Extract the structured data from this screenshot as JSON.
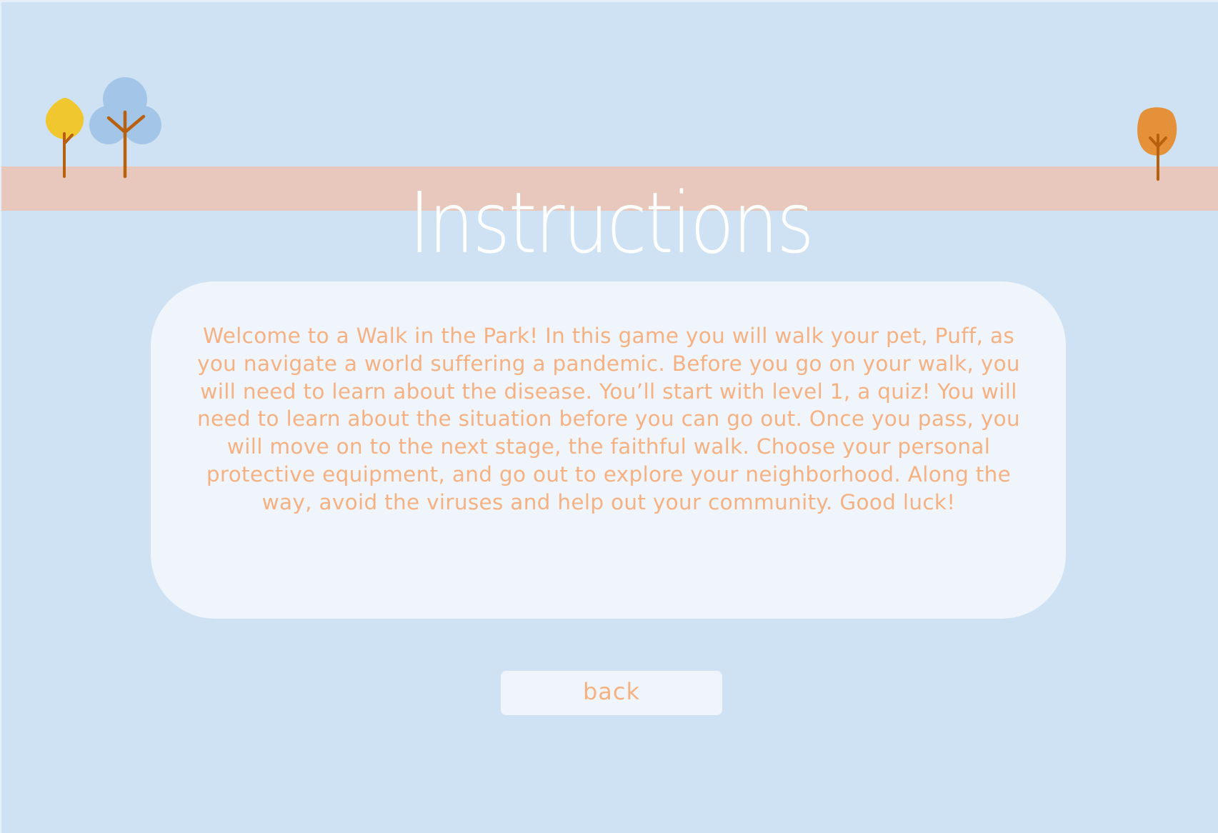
{
  "title": "Instructions",
  "instructions_text": "Welcome to a Walk in the Park! In this game you will walk your pet, Puff, as you navigate a world suffering a pandemic. Before you go on your walk, you will need to learn about the disease. You’ll start with level 1, a quiz! You will need to learn about the situation before you can go out. Once you pass, you will move on to the next stage, the faithful walk. Choose your personal protective equipment, and go out to explore your neighborhood. Along the way, avoid the viruses and help out your community. Good luck!",
  "back_button_label": "back",
  "decorations": {
    "trees": [
      "yellow-tree-icon",
      "blue-tree-icon",
      "orange-tree-icon"
    ]
  },
  "colors": {
    "background": "#cfe2f3",
    "ground_band": "#e8c8bc",
    "panel": "#eff5fb",
    "text_accent": "#f6b183",
    "title": "#ffffff",
    "trunk": "#b8600e",
    "yellow_tree": "#f1c72f",
    "blue_tree": "#a3c6e8",
    "orange_tree": "#e5913a"
  }
}
